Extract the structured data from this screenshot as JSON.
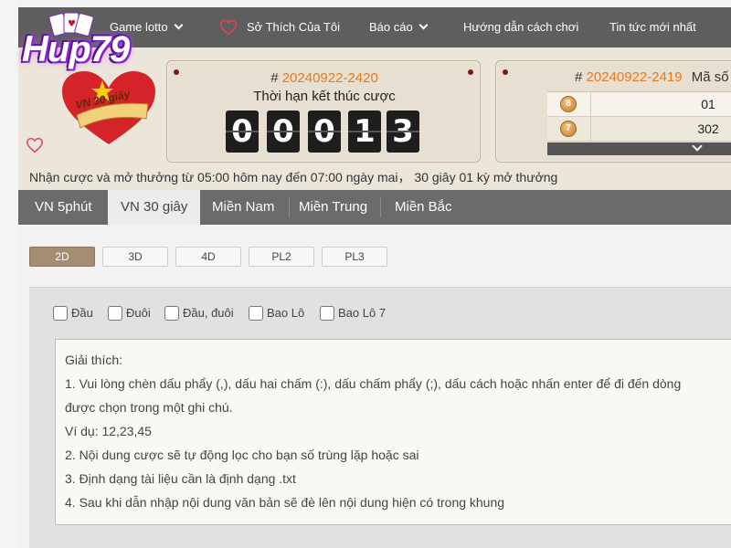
{
  "nav": {
    "game_lotto": "Game lotto",
    "favorites": "Sở Thích Của Tôi",
    "report": "Báo cáo",
    "guide": "Hướng dẫn cách chơi",
    "news": "Tin tức mới nhất"
  },
  "logo": {
    "brand": "Hup79",
    "badge": "VN 30 giây"
  },
  "current_draw": {
    "hash": "#",
    "issue": "20240922-2420",
    "deadline_label": "Thời hạn kết thúc cược",
    "countdown": [
      "0",
      "0",
      "0",
      "1",
      "3"
    ]
  },
  "previous_draw": {
    "hash": "#",
    "issue": "20240922-2419",
    "code_label": "Mã số",
    "rows": [
      {
        "ball": "8",
        "value": "01"
      },
      {
        "ball": "7",
        "value": "302"
      }
    ]
  },
  "info_text": "Nhận cược và mở thưởng từ 05:00 hôm nay đến 07:00 ngày mai，  30 giây 01 kỳ mở thưởng",
  "tabs": [
    {
      "label": "VN 5phút"
    },
    {
      "label": "VN 30 giây"
    },
    {
      "label": "Miền Nam"
    },
    {
      "label": "Miền Trung"
    },
    {
      "label": "Miền Bắc"
    }
  ],
  "subtabs": [
    {
      "label": "2D"
    },
    {
      "label": "3D"
    },
    {
      "label": "4D"
    },
    {
      "label": "PL2"
    },
    {
      "label": "PL3"
    }
  ],
  "checkboxes": [
    {
      "label": "Đầu"
    },
    {
      "label": "Đuôi"
    },
    {
      "label": "Đầu, đuôi"
    },
    {
      "label": "Bao Lô"
    },
    {
      "label": "Bao Lô 7"
    }
  ],
  "explanation": {
    "title": "Giải thích:",
    "line1": "1. Vui lòng chèn dấu phẩy (,), dấu hai chấm (:), dấu chấm phẩy (;), dấu cách hoặc nhấn enter để đi đến dòng",
    "line1b": "được chọn trong một ghi chú.",
    "example": "Ví dụ: 12,23,45",
    "line2": "2. Nội dung cược sẽ tự động lọc cho bạn số trùng lặp hoặc sai",
    "line3": "3. Định dạng tài liệu cần là định dạng .txt",
    "line4": "4. Sau khi dẫn nhập nội dung văn bản sẽ đè lên nội dung hiện có trong khung"
  },
  "colors": {
    "accent_orange": "#e8791c",
    "nav_gray": "#5e5e5e",
    "active_subtab": "#a68c73"
  }
}
